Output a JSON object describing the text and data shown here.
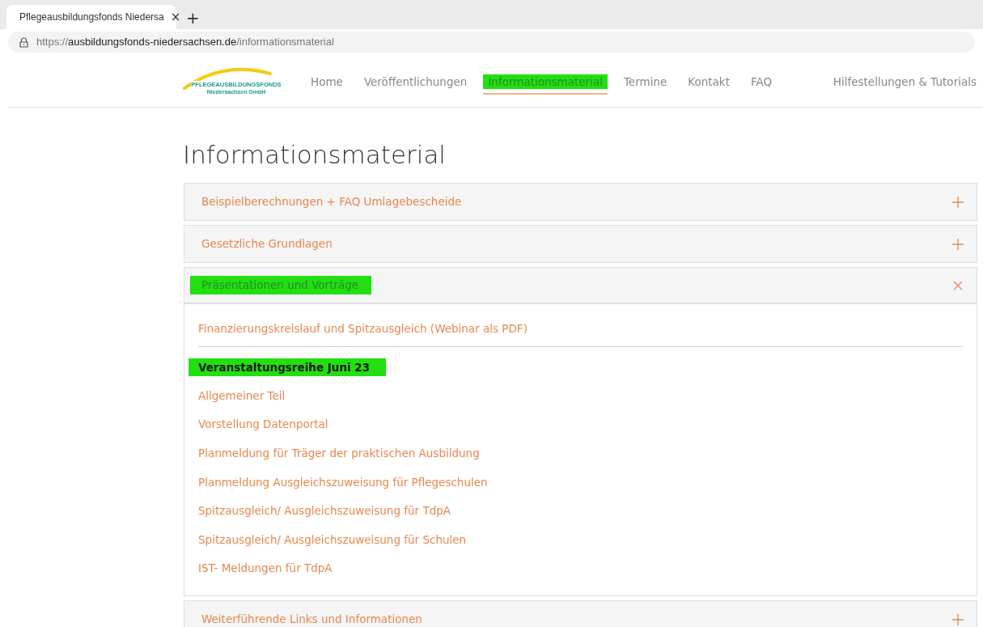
{
  "browser": {
    "tab": {
      "title": "Pflegeausbildungsfonds Niedersa",
      "close": "×",
      "selected": true
    },
    "new_tab": "+",
    "url": {
      "scheme": "https://",
      "domain": "ausbildungsfonds-niedersachsen.de",
      "path": "/informationsmaterial"
    }
  },
  "logo": {
    "line_1": "PFLEGEAUSBILDUNGSFONDS",
    "line_2": "Niedersachsen GmbH"
  },
  "nav": [
    {
      "label": "Home",
      "selected": false,
      "highlighted": false
    },
    {
      "label": "Veröffentlichungen",
      "selected": false,
      "highlighted": false
    },
    {
      "label": "Informationsmaterial",
      "selected": true,
      "highlighted": true
    },
    {
      "label": "Termine",
      "selected": false,
      "highlighted": false
    },
    {
      "label": "Kontakt",
      "selected": false,
      "highlighted": false
    },
    {
      "label": "FAQ",
      "selected": false,
      "highlighted": false
    }
  ],
  "nav_right": "Hilfestellungen & Tutorials",
  "page_title": "Informationsmaterial",
  "accordion": [
    {
      "title": "Beispielberechnungen + FAQ Umlagebescheide",
      "expanded": false,
      "highlighted": false
    },
    {
      "title": "Gesetzliche Grundlagen",
      "expanded": false,
      "highlighted": false
    },
    {
      "title": "Präsentationen und Vorträge",
      "expanded": true,
      "highlighted": true,
      "content": [
        {
          "kind": "link",
          "text": "Finanzierungskreislauf und Spitzausgleich (Webinar als PDF)"
        },
        {
          "kind": "divider"
        },
        {
          "kind": "heading",
          "text": "Veranstaltungsreihe Juni 23",
          "highlighted": true
        },
        {
          "kind": "link",
          "text": "Allgemeiner Teil"
        },
        {
          "kind": "link",
          "text": "Vorstellung Datenportal"
        },
        {
          "kind": "link",
          "text": "Planmeldung für Träger der praktischen Ausbildung"
        },
        {
          "kind": "link",
          "text": "Planmeldung Ausgleichszuweisung für Pflegeschulen"
        },
        {
          "kind": "link",
          "text": "Spitzausgleich/ Ausgleichszuweisung für TdpA"
        },
        {
          "kind": "link",
          "text": "Spitzausgleich/ Ausgleichszuweisung für Schulen"
        },
        {
          "kind": "link",
          "text": "IST- Meldungen für TdpA"
        }
      ]
    },
    {
      "title": "Weiterführende Links und Informationen",
      "expanded": false,
      "highlighted": false
    }
  ]
}
